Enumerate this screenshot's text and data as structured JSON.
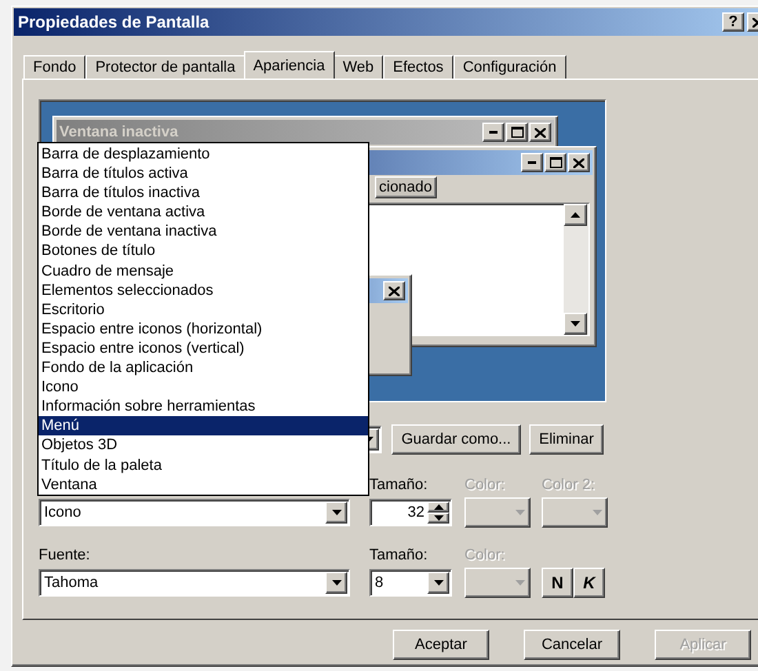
{
  "window": {
    "title": "Propiedades de Pantalla",
    "help": "?"
  },
  "tabs": [
    {
      "label": "Fondo",
      "selected": false
    },
    {
      "label": "Protector de pantalla",
      "selected": false
    },
    {
      "label": "Apariencia",
      "selected": true
    },
    {
      "label": "Web",
      "selected": false
    },
    {
      "label": "Efectos",
      "selected": false
    },
    {
      "label": "Configuración",
      "selected": false
    }
  ],
  "preview": {
    "inactive_window": {
      "title": "Ventana inactiva"
    },
    "active_window": {
      "menu_item": "cionado"
    }
  },
  "element_list": [
    {
      "label": "Barra de desplazamiento",
      "selected": false
    },
    {
      "label": "Barra de títulos activa",
      "selected": false
    },
    {
      "label": "Barra de títulos inactiva",
      "selected": false
    },
    {
      "label": "Borde de ventana activa",
      "selected": false
    },
    {
      "label": "Borde de ventana inactiva",
      "selected": false
    },
    {
      "label": "Botones de título",
      "selected": false
    },
    {
      "label": "Cuadro de mensaje",
      "selected": false
    },
    {
      "label": "Elementos seleccionados",
      "selected": false
    },
    {
      "label": "Escritorio",
      "selected": false
    },
    {
      "label": "Espacio entre iconos (horizontal)",
      "selected": false
    },
    {
      "label": "Espacio entre iconos (vertical)",
      "selected": false
    },
    {
      "label": "Fondo de la aplicación",
      "selected": false
    },
    {
      "label": "Icono",
      "selected": false
    },
    {
      "label": "Información sobre herramientas",
      "selected": false
    },
    {
      "label": "Menú",
      "selected": true
    },
    {
      "label": "Objetos 3D",
      "selected": false
    },
    {
      "label": "Título de la paleta",
      "selected": false
    },
    {
      "label": "Ventana",
      "selected": false
    }
  ],
  "scheme_buttons": [
    "Guardar como...",
    "Eliminar"
  ],
  "item_row": {
    "element": "Icono",
    "labels": [
      {
        "text": "Tamaño:",
        "disabled": false
      },
      {
        "text": "Color:",
        "disabled": true
      },
      {
        "text": "Color 2:",
        "disabled": true
      }
    ],
    "size": "32"
  },
  "font_row": {
    "label": "Fuente:",
    "font": "Tahoma",
    "labels": [
      {
        "text": "Tamaño:",
        "disabled": false
      },
      {
        "text": "Color:",
        "disabled": true
      }
    ],
    "size": "8",
    "bold": "N",
    "italic": "K"
  },
  "buttons": [
    {
      "label": "Aceptar",
      "disabled": false
    },
    {
      "label": "Cancelar",
      "disabled": false
    },
    {
      "label": "Aplicar",
      "disabled": true
    }
  ]
}
